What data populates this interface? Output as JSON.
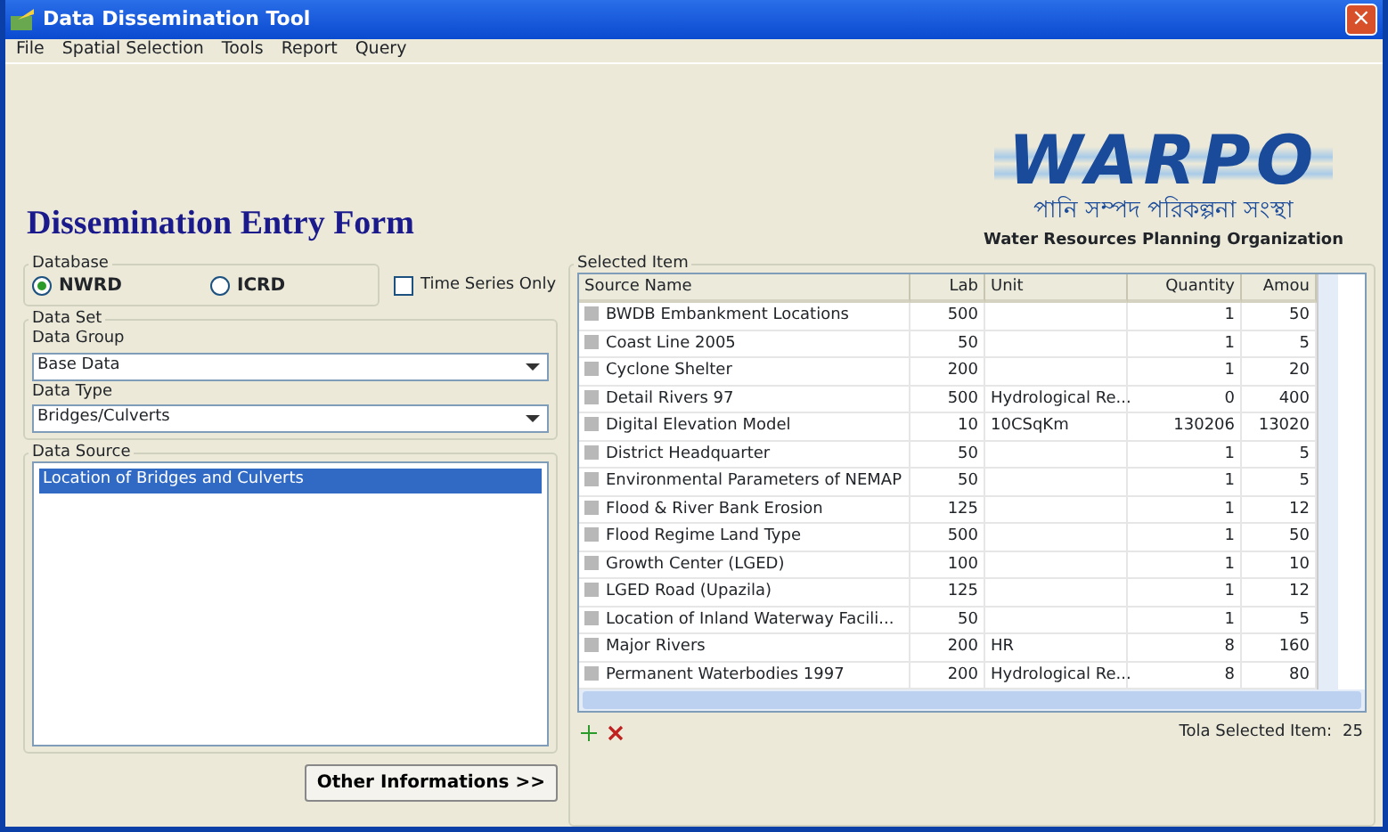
{
  "window": {
    "title": "Data Dissemination Tool",
    "close": "×"
  },
  "menu": [
    "File",
    "Spatial Selection",
    "Tools",
    "Report",
    "Query"
  ],
  "form_title": "Dissemination Entry Form",
  "logo": {
    "name": "WARPO",
    "bengali": "পানি সম্পদ পরিকল্পনা সংস্থা",
    "subtitle": "Water Resources Planning Organization"
  },
  "database": {
    "label": "Database",
    "options": [
      {
        "label": "NWRD",
        "selected": true
      },
      {
        "label": "ICRD",
        "selected": false
      }
    ],
    "time_series": {
      "label": "Time Series Only",
      "checked": false
    }
  },
  "data_set": {
    "label": "Data Set",
    "group_label": "Data Group",
    "group_value": "Base Data",
    "type_label": "Data Type",
    "type_value": "Bridges/Culverts"
  },
  "data_source": {
    "label": "Data Source",
    "items": [
      {
        "label": "Location of Bridges and Culverts",
        "selected": true
      }
    ]
  },
  "other_button": "Other Informations >>",
  "selected_items": {
    "label": "Selected Item",
    "columns": [
      "Source Name",
      "Lab",
      "Unit",
      "Quantity",
      "Amou"
    ],
    "rows": [
      [
        "BWDB Embankment Locations",
        "500",
        "",
        "1",
        "50"
      ],
      [
        "Coast Line 2005",
        "50",
        "",
        "1",
        "5"
      ],
      [
        "Cyclone Shelter",
        "200",
        "",
        "1",
        "20"
      ],
      [
        "Detail Rivers 97",
        "500",
        "Hydrological Re...",
        "0",
        "400"
      ],
      [
        "Digital Elevation Model",
        "10",
        "10CSqKm",
        "130206",
        "13020"
      ],
      [
        "District Headquarter",
        "50",
        "",
        "1",
        "5"
      ],
      [
        "Environmental Parameters of NEMAP",
        "50",
        "",
        "1",
        "5"
      ],
      [
        "Flood & River Bank Erosion",
        "125",
        "",
        "1",
        "12"
      ],
      [
        "Flood Regime Land Type",
        "500",
        "",
        "1",
        "50"
      ],
      [
        "Growth Center (LGED)",
        "100",
        "",
        "1",
        "10"
      ],
      [
        "LGED Road (Upazila)",
        "125",
        "",
        "1",
        "12"
      ],
      [
        "Location of Inland Waterway Facili...",
        "50",
        "",
        "1",
        "5"
      ],
      [
        "Major Rivers",
        "200",
        "HR",
        "8",
        "160"
      ],
      [
        "Permanent Waterbodies 1997",
        "200",
        "Hydrological Re...",
        "8",
        "80"
      ]
    ]
  },
  "total": {
    "label": "Tola Selected Item:",
    "value": "25"
  }
}
